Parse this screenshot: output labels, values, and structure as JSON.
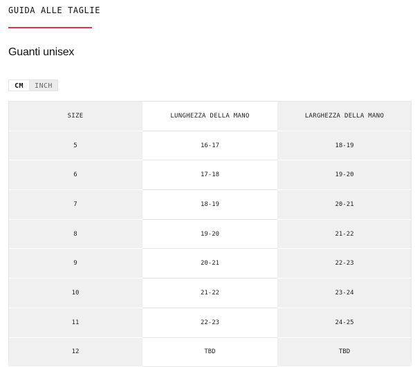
{
  "tab": {
    "title": "GUIDA ALLE TAGLIE",
    "accent_color": "#e0334a"
  },
  "product": {
    "title": "Guanti unisex"
  },
  "units": {
    "cm_label": "CM",
    "inch_label": "INCH",
    "selected": "CM"
  },
  "table": {
    "headers": [
      "SIZE",
      "LUNGHEZZA DELLA MANO",
      "LARGHEZZA DELLA MANO"
    ],
    "rows": [
      [
        "5",
        "16-17",
        "18-19"
      ],
      [
        "6",
        "17-18",
        "19-20"
      ],
      [
        "7",
        "18-19",
        "20-21"
      ],
      [
        "8",
        "19-20",
        "21-22"
      ],
      [
        "9",
        "20-21",
        "22-23"
      ],
      [
        "10",
        "21-22",
        "23-24"
      ],
      [
        "11",
        "22-23",
        "24-25"
      ],
      [
        "12",
        "TBD",
        "TBD"
      ]
    ]
  }
}
